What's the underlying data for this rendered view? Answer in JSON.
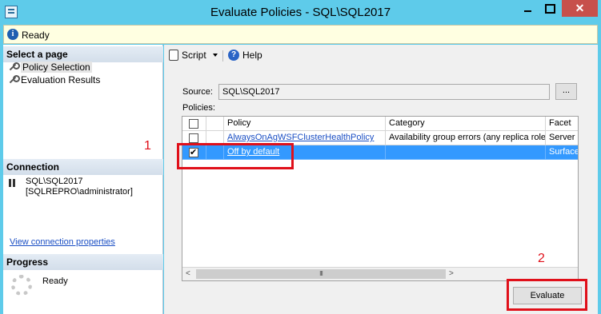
{
  "window": {
    "title": "Evaluate Policies - SQL\\SQL2017",
    "close_glyph": "✕"
  },
  "status": {
    "text": "Ready",
    "icon": "info-icon"
  },
  "left": {
    "select_page_header": "Select a page",
    "pages": [
      {
        "label": "Policy Selection",
        "icon": "wrench-icon",
        "selected": true
      },
      {
        "label": "Evaluation Results",
        "icon": "wrench-icon",
        "selected": false
      }
    ],
    "connection_header": "Connection",
    "server": "SQL\\SQL2017",
    "user": "[SQLREPRO\\administrator]",
    "connection_link": "View connection properties",
    "progress_header": "Progress",
    "progress_status": "Ready"
  },
  "toolbar": {
    "script_label": "Script",
    "help_label": "Help"
  },
  "source": {
    "label": "Source:",
    "value": "SQL\\SQL2017",
    "browse_label": "..."
  },
  "policies": {
    "label": "Policies:",
    "columns": [
      "Policy",
      "Category",
      "Facet"
    ],
    "rows": [
      {
        "checked": false,
        "policy": "AlwaysOnAgWSFClusterHealthPolicy",
        "category": "Availability group errors (any replica role)",
        "facet": "Server",
        "selected": false
      },
      {
        "checked": true,
        "policy": "Off by default",
        "category": "",
        "facet": "Surface",
        "selected": true
      }
    ]
  },
  "scrollbar": {
    "left_arrow": "<",
    "right_arrow": ">",
    "grip": "III"
  },
  "evaluate_label": "Evaluate",
  "annotations": {
    "one": "1",
    "two": "2",
    "color": "#e0101a"
  }
}
